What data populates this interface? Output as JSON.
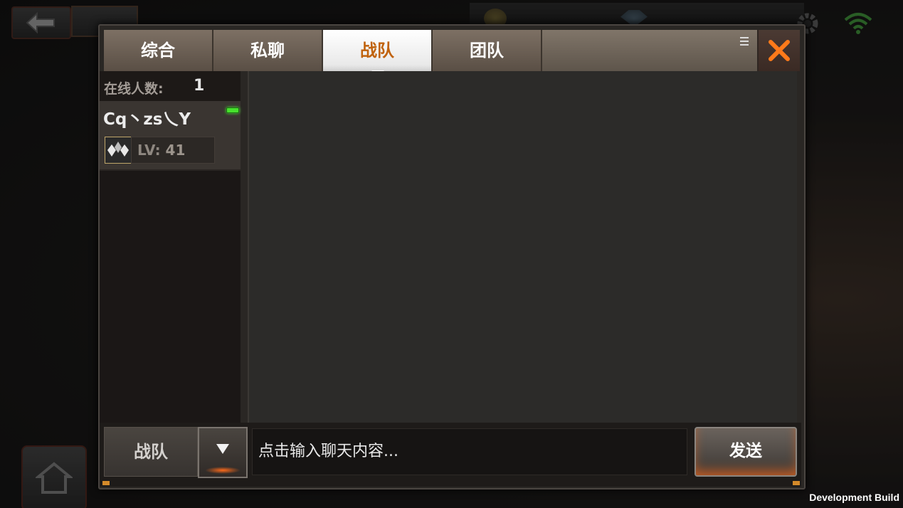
{
  "tabs": [
    {
      "label": "综合",
      "active": false
    },
    {
      "label": "私聊",
      "active": false
    },
    {
      "label": "战队",
      "active": true
    },
    {
      "label": "团队",
      "active": false
    }
  ],
  "online": {
    "label": "在线人数:",
    "count": "1"
  },
  "members": [
    {
      "name": "Cq丶zs乀Y",
      "level_label": "LV:",
      "level": "41",
      "status": "online"
    }
  ],
  "input": {
    "channel": "战队",
    "placeholder": "点击输入聊天内容...",
    "send_label": "发送"
  },
  "footer": {
    "build": "Development Build"
  },
  "icons": {
    "back": "back-arrow-icon",
    "coin": "coin-icon",
    "gem": "gem-icon",
    "settings": "gear-icon",
    "signal": "wifi-icon",
    "close": "close-icon",
    "dropdown": "chevron-down-icon",
    "rank": "rank-badge-icon",
    "home": "home-icon"
  },
  "colors": {
    "accent": "#ff7a1a",
    "active_tab_text": "#c0620c",
    "online": "#47e12d"
  }
}
